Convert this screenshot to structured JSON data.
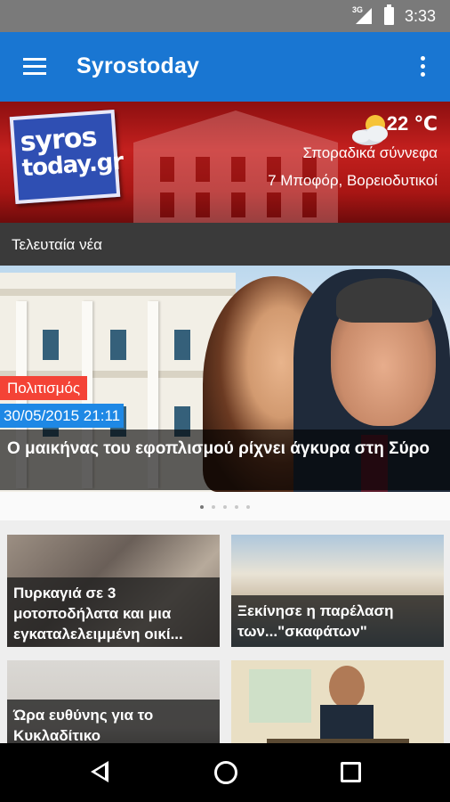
{
  "status_bar": {
    "network": "3G",
    "time": "3:33"
  },
  "app_bar": {
    "title": "Syrostoday"
  },
  "banner": {
    "logo_line1": "syros",
    "logo_line2": "today.gr",
    "temperature": "22 ℃",
    "condition": "Σποραδικά σύννεφα",
    "wind": "7  Μποφόρ, Βορειοδυτικοί"
  },
  "section": {
    "title": "Τελευταία νέα"
  },
  "featured": {
    "category": "Πολιτισμός",
    "date": "30/05/2015 21:11",
    "headline": "Ο μαικήνας του εφοπλισμού ρίχνει άγκυρα στη Σύρο"
  },
  "pager": {
    "count": 5,
    "active": 1
  },
  "cards": [
    {
      "title": "Πυρκαγιά σε 3 μοτοποδήλατα και μια εγκαταλελειμμένη οικί..."
    },
    {
      "title": "Ξεκίνησε η παρέλαση των...\"σκαφάτων\""
    },
    {
      "title": "Ώρα ευθύνης για το Κυκλαδίτικο"
    },
    {
      "title": ""
    }
  ]
}
